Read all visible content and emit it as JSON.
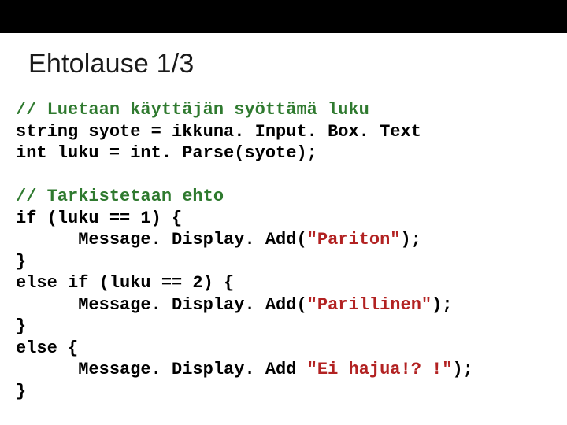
{
  "title": "Ehtolause 1/3",
  "code": {
    "c1": "// Luetaan käyttäjän syöttämä luku",
    "l2": "string syote = ikkuna. Input. Box. Text",
    "l3": "int luku = int. Parse(syote);",
    "c2": "// Tarkistetaan ehto",
    "l5": "if (luku == 1) {",
    "l6a": "      Message. Display. Add(",
    "l6s": "\"Pariton\"",
    "l6b": ");",
    "l7": "}",
    "l8": "else if (luku == 2) {",
    "l9a": "      Message. Display. Add(",
    "l9s": "\"Parillinen\"",
    "l9b": ");",
    "l10": "}",
    "l11": "else {",
    "l12a": "      Message. Display. Add ",
    "l12s": "\"Ei hajua!? !\"",
    "l12b": ");",
    "l13": "}"
  }
}
